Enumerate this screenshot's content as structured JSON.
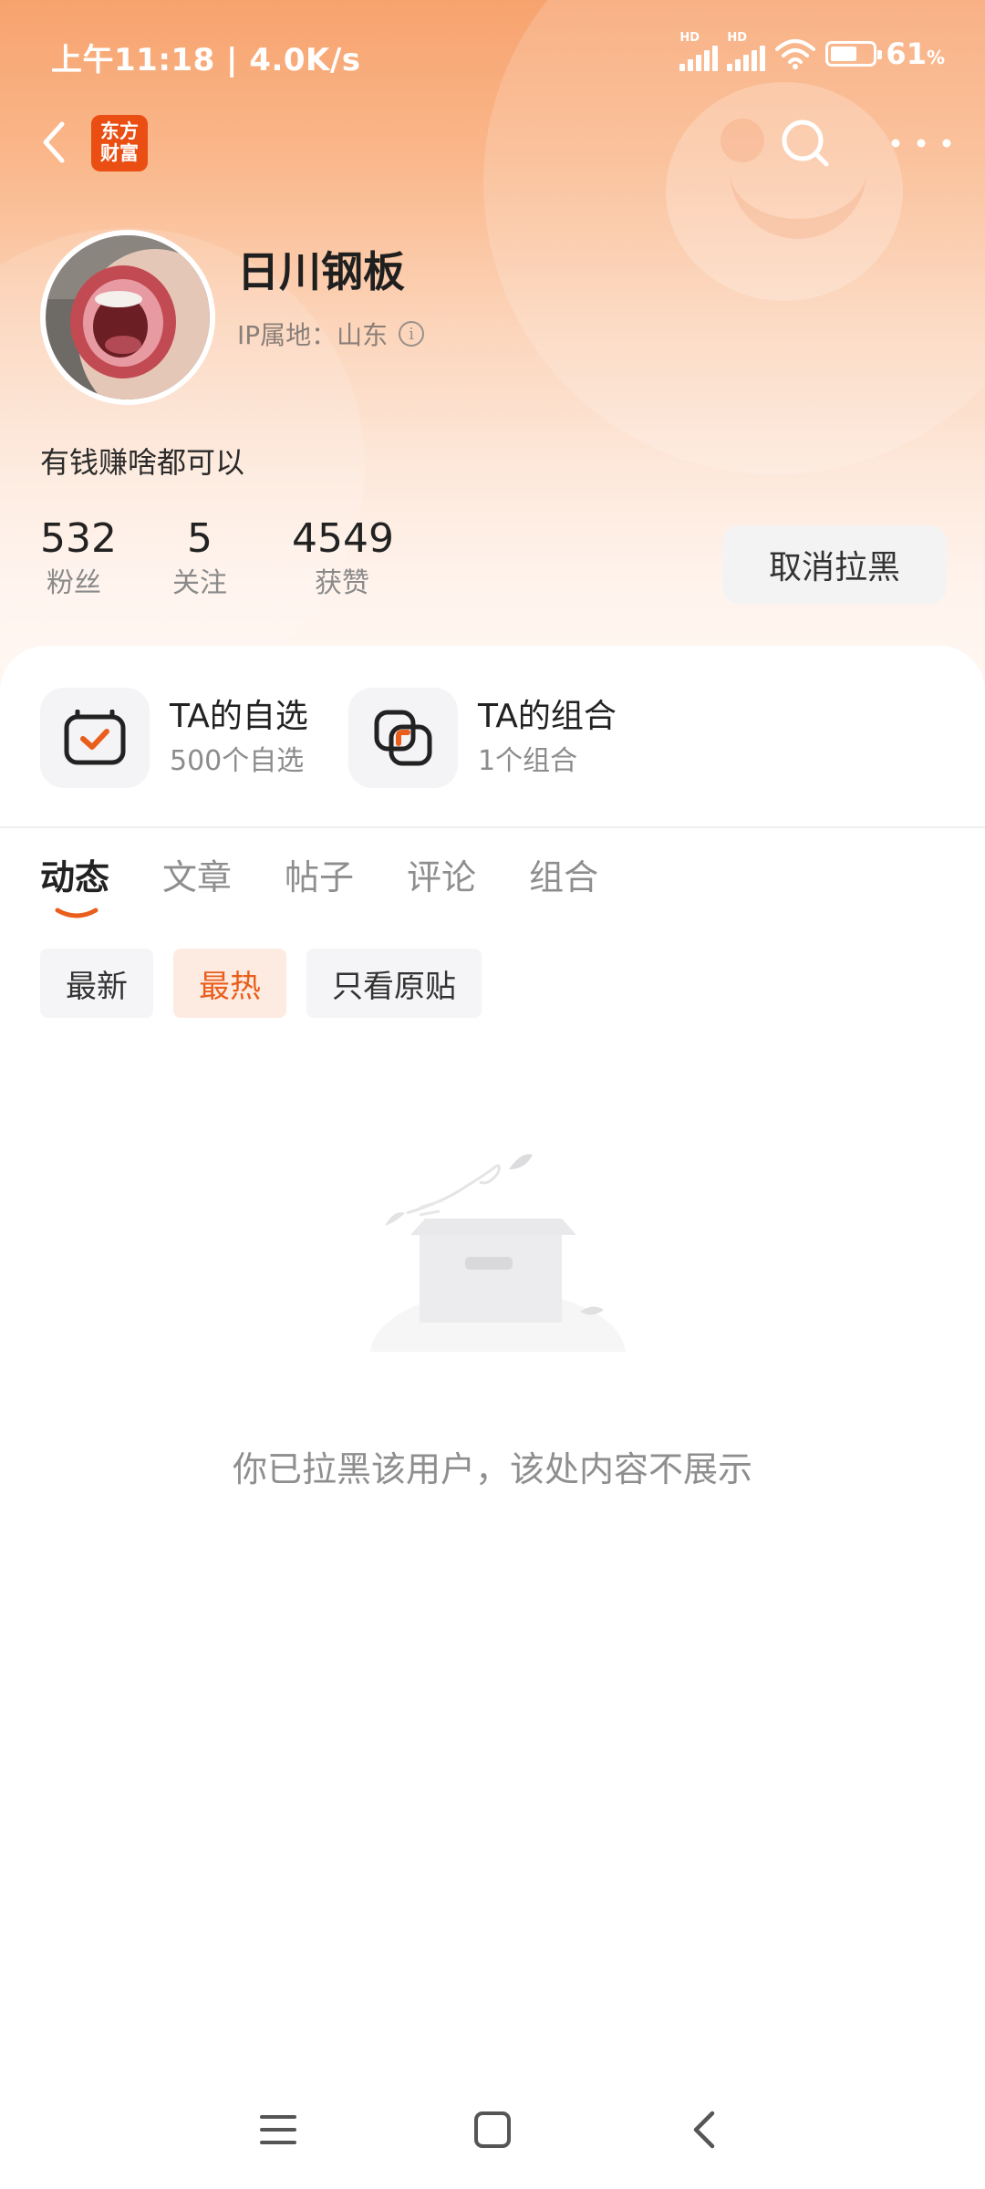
{
  "status_bar": {
    "time": "上午11:18 | 4.0K/s",
    "battery_percent": "61",
    "battery_unit": "%",
    "network_label": "HD"
  },
  "header": {
    "logo_text_line1": "东方",
    "logo_text_line2": "财富"
  },
  "profile": {
    "name": "日川钢板",
    "ip_location": "IP属地：山东",
    "bio": "有钱赚啥都可以",
    "stats": [
      {
        "value": "532",
        "label": "粉丝"
      },
      {
        "value": "5",
        "label": "关注"
      },
      {
        "value": "4549",
        "label": "获赞"
      }
    ],
    "unblock_label": "取消拉黑"
  },
  "entries": {
    "watchlist": {
      "title": "TA的自选",
      "subtitle": "500个自选"
    },
    "portfolio": {
      "title": "TA的组合",
      "subtitle": "1个组合"
    }
  },
  "tabs": [
    {
      "label": "动态",
      "active": true
    },
    {
      "label": "文章",
      "active": false
    },
    {
      "label": "帖子",
      "active": false
    },
    {
      "label": "评论",
      "active": false
    },
    {
      "label": "组合",
      "active": false
    }
  ],
  "filters": [
    {
      "label": "最新",
      "active": false
    },
    {
      "label": "最热",
      "active": true
    },
    {
      "label": "只看原贴",
      "active": false
    }
  ],
  "empty_state": {
    "message": "你已拉黑该用户，该处内容不展示"
  },
  "colors": {
    "accent": "#ea5e1b",
    "brand": "#ea4e13",
    "header_gradient_top": "#f7a36e"
  }
}
